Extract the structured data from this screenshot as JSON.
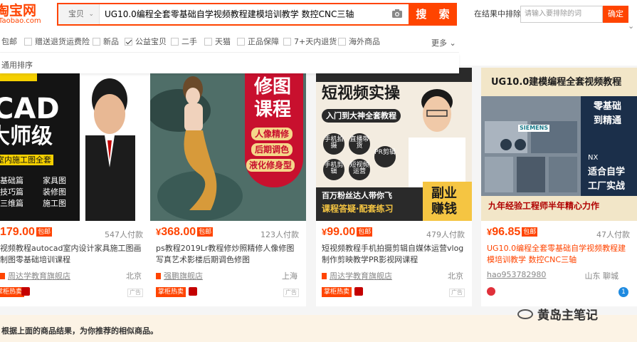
{
  "header": {
    "logo_main": "淘宝网",
    "logo_sub": "Taobao.com",
    "search_scope": "宝贝",
    "search_query": "UG10.0编程全套零基础自学视频教程建模培训教学 数控CNC三轴",
    "search_button": "搜 索",
    "exclude_label": "在结果中排除",
    "exclude_placeholder": "请输入要排除的词",
    "exclude_button": "确定",
    "colors": {
      "accent": "#ff4400"
    }
  },
  "filters": [
    {
      "label": "包邮",
      "checked": false
    },
    {
      "label": "赠送退货运费险",
      "checked": false
    },
    {
      "label": "新品",
      "checked": false
    },
    {
      "label": "公益宝贝",
      "checked": true
    },
    {
      "label": "二手",
      "checked": false
    },
    {
      "label": "天猫",
      "checked": false
    },
    {
      "label": "正品保障",
      "checked": false
    },
    {
      "label": "7+天内退货",
      "checked": false
    },
    {
      "label": "海外商品",
      "checked": false
    }
  ],
  "more_label": "更多",
  "sort_label": "通用排序",
  "products": [
    {
      "price_symbol": "",
      "price": "179.00",
      "badge": "包邮",
      "sold": "547人付款",
      "title": "视频教程autocad室内设计家具施工图画制图零基础培训课程",
      "shop": "周达学教育旗舰店",
      "location": "北京",
      "tag": "掌柜热卖",
      "ad": "广告",
      "image_text": [
        "CAD",
        "大师级",
        "室内施工图全套",
        "基础篇",
        "家具图",
        "技巧篇",
        "装修图",
        "三维篇",
        "施工图"
      ]
    },
    {
      "price_symbol": "¥",
      "price": "368.00",
      "badge": "包邮",
      "sold": "123人付款",
      "title": "ps教程2019Lr教程修炒照精修人像修图写真艺术影楼后期调色修图",
      "shop": "强鹏旗舰店",
      "location": "上海",
      "tag": "掌柜热卖",
      "ad": "广告",
      "image_text": [
        "修图",
        "课程",
        "人像精修",
        "后期调色",
        "液化修身型"
      ]
    },
    {
      "price_symbol": "¥",
      "price": "99.00",
      "badge": "包邮",
      "sold": "479人付款",
      "title": "短视频教程手机拍摄剪辑自媒体运营vlog制作剪映教学PR影视网课程",
      "shop": "周达学教育旗舰店",
      "location": "北京",
      "tag": "掌柜热卖",
      "ad": "广告",
      "image_text": [
        "短视频实操",
        "入门到大神全套教程",
        "手机拍摄",
        "直播带货",
        "PR剪辑",
        "手机剪辑",
        "短视频运营",
        "百万粉丝达人带你飞",
        "课程答疑·配套练习",
        "副业",
        "赚钱"
      ]
    },
    {
      "price_symbol": "¥",
      "price": "96.85",
      "badge": "包邮",
      "sold": "47人付款",
      "title": "UG10.0编程全套零基础自学视频教程建模培训教学 数控CNC三轴",
      "shop": "hao953782980",
      "location": "山东 聊城",
      "tag": "",
      "ad": "",
      "image_text": [
        "UG10.0建模编程全套视频教程",
        "零基础",
        "到精通",
        "NX",
        "适合自学",
        "工厂实战",
        "九年经验工程师半年精心力作",
        "SIEMENS"
      ]
    }
  ],
  "recommend_text": "根据上面的商品结果，为你推荐的相似商品。",
  "watermark": "黄岛主笔记"
}
